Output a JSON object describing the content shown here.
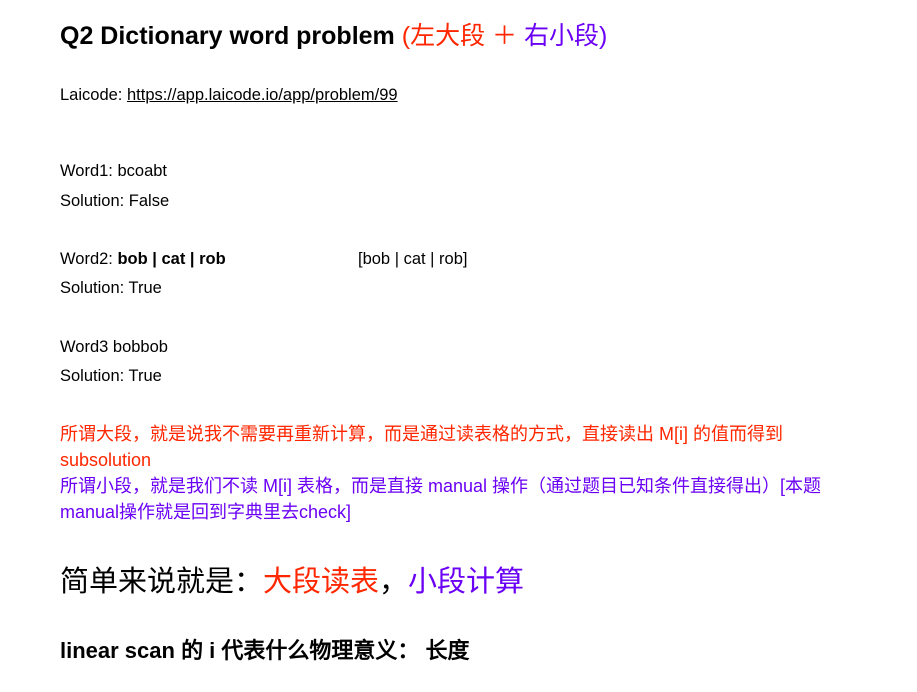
{
  "title": {
    "main": "Q2 Dictionary word problem",
    "open_paren": " (",
    "left_part": "左大段",
    "plus": " ＋ ",
    "right_part": "右小段",
    "close_paren": ")"
  },
  "laicode": {
    "label": "Laicode: ",
    "url": "https://app.laicode.io/app/problem/99"
  },
  "examples": [
    {
      "word_label": "Word1:  ",
      "word": "bcoabt",
      "solution": "Solution: False"
    },
    {
      "word_label": "Word2: ",
      "word": "bob | cat | rob",
      "note": "[bob | cat | rob]",
      "solution": "Solution: True"
    },
    {
      "word_label": "Word3  ",
      "word": "bobbob",
      "solution": "Solution: True"
    }
  ],
  "explanation": {
    "big_segment": "所谓大段，就是说我不需要再重新计算，而是通过读表格的方式，直接读出 M[i] 的值而得到 subsolution",
    "small_segment": "所谓小段，就是我们不读 M[i] 表格，而是直接 manual 操作（通过题目已知条件直接得出）[本题manual操作就是回到字典里去check]"
  },
  "summary": {
    "prefix": "简单来说就是：",
    "big": "大段读表",
    "comma": "，",
    "small": "小段计算"
  },
  "linear_scan": {
    "text": "linear scan 的 i 代表什么物理意义：  长度"
  },
  "colors": {
    "red": "#ff2600",
    "purple": "#6a00f4"
  }
}
